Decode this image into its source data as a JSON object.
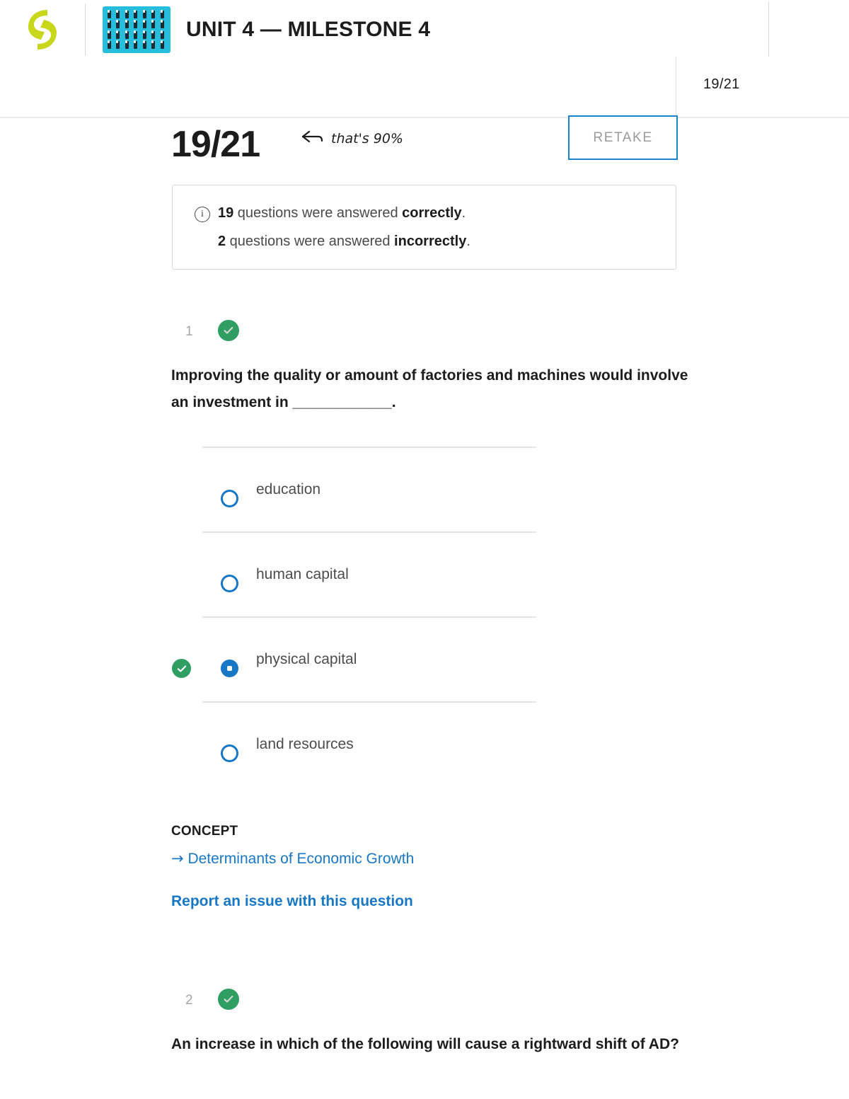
{
  "header": {
    "logo_name": "sophia-logo",
    "unit_icon_name": "unit-thumbnail-icon",
    "title": "UNIT 4 — MILESTONE 4",
    "score_compact": "19/21"
  },
  "score_row": {
    "score": "19/21",
    "annotation": "that's 90%",
    "annotation_arrow": "←",
    "retake_label": "RETAKE"
  },
  "info_box": {
    "icon": "info-icon",
    "correct_count": "19",
    "correct_text_pre": " questions were answered ",
    "correct_word": "correctly",
    "period": ".",
    "incorrect_count": "2",
    "incorrect_text_pre": " questions were answered ",
    "incorrect_word": "incorrectly"
  },
  "colors": {
    "accent_blue": "#1878c5",
    "correct_green": "#2e9e63",
    "logo_lime": "#c8d719",
    "unit_icon_cyan": "#27bede",
    "muted_gray": "#a6a6a6"
  },
  "questions": [
    {
      "number": "1",
      "status": "correct",
      "status_icon": "check-circle-icon",
      "text": "Improving the quality or amount of factories and machines would involve an investment in ____________.",
      "options": [
        {
          "label": "education",
          "selected": false,
          "correct": false
        },
        {
          "label": "human capital",
          "selected": false,
          "correct": false
        },
        {
          "label": "physical capital",
          "selected": true,
          "correct": true
        },
        {
          "label": "land resources",
          "selected": false,
          "correct": false
        }
      ],
      "concept_heading": "CONCEPT",
      "concept_link": "Determinants of Economic Growth",
      "concept_arrow": "→",
      "report_link": "Report an issue with this question"
    },
    {
      "number": "2",
      "status": "correct",
      "status_icon": "check-circle-icon",
      "text": "An increase in which of the following will cause a rightward shift of AD?",
      "options": [],
      "concept_heading": "",
      "concept_link": "",
      "concept_arrow": "",
      "report_link": ""
    }
  ]
}
